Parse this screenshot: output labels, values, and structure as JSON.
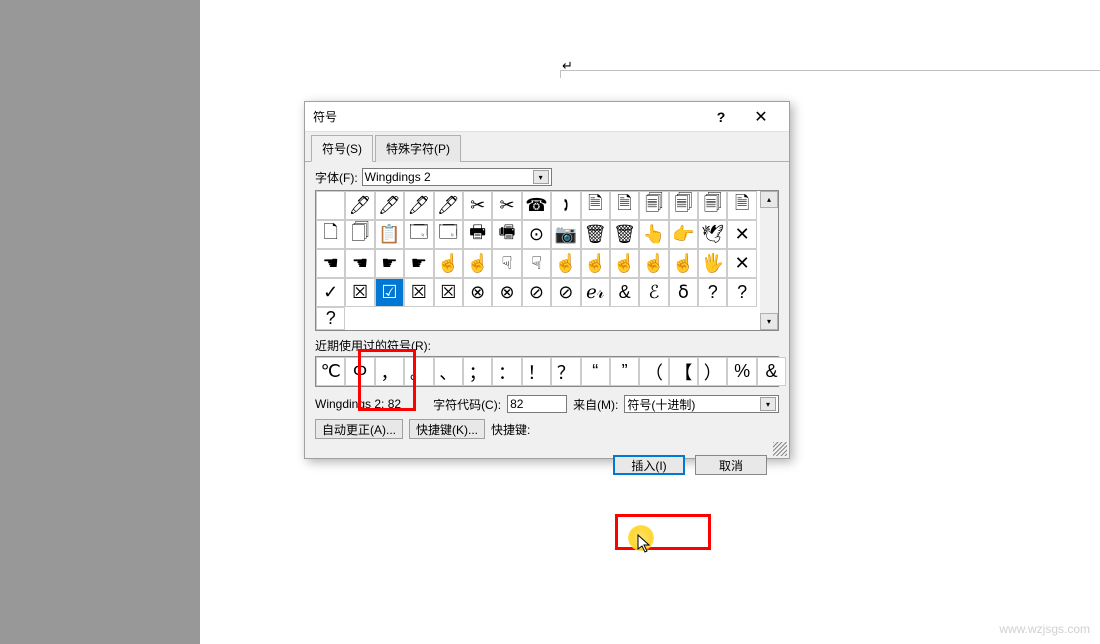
{
  "dialog": {
    "title": "符号",
    "help": "?",
    "close": "✕"
  },
  "tabs": {
    "symbols": "符号(S)",
    "special": "特殊字符(P)"
  },
  "font": {
    "label": "字体(F):",
    "value": "Wingdings 2"
  },
  "grid": {
    "cells": [
      "",
      "🖊",
      "🖊",
      "🖊",
      "🖊",
      "✂",
      "✂",
      "☎",
      "🕽",
      "🗎",
      "🗎",
      "🗐",
      "🗐",
      "🗐",
      "🗎",
      "🗋",
      "🗍",
      "📋",
      "🗔",
      "🗔",
      "🖶",
      "🖷",
      "⊙",
      "📷",
      "🗑",
      "🗑",
      "👆",
      "👉",
      "🕊",
      "✕",
      "☚",
      "☚",
      "☛",
      "☛",
      "☝",
      "☝",
      "☟",
      "☟",
      "☝",
      "☝",
      "☝",
      "☝",
      "☝",
      "🖐",
      "✕",
      "✓",
      "☒",
      "☑",
      "☒",
      "☒",
      "⊗",
      "⊗",
      "⊘",
      "⊘",
      "ℯ𝓇",
      "&",
      "ℰ",
      "ẟ",
      "?",
      "?",
      "?"
    ],
    "selected_index": 47
  },
  "recent": {
    "label": "近期使用过的符号(R):",
    "cells": [
      "℃",
      "Φ",
      "，",
      "。",
      "、",
      "；",
      "：",
      "！",
      "？",
      "“",
      "”",
      "（",
      "【",
      "）",
      "%",
      "&"
    ]
  },
  "info": {
    "name": "Wingdings 2: 82",
    "code_label": "字符代码(C):",
    "code_value": "82",
    "from_label": "来自(M):",
    "from_value": "符号(十进制)"
  },
  "shortcuts": {
    "autocorrect": "自动更正(A)...",
    "shortcut_key": "快捷键(K)...",
    "shortcut_label": "快捷键:"
  },
  "footer": {
    "insert": "插入(I)",
    "cancel": "取消"
  },
  "page": {
    "cursor_mark": "↵"
  },
  "watermark": "www.wzjsgs.com"
}
